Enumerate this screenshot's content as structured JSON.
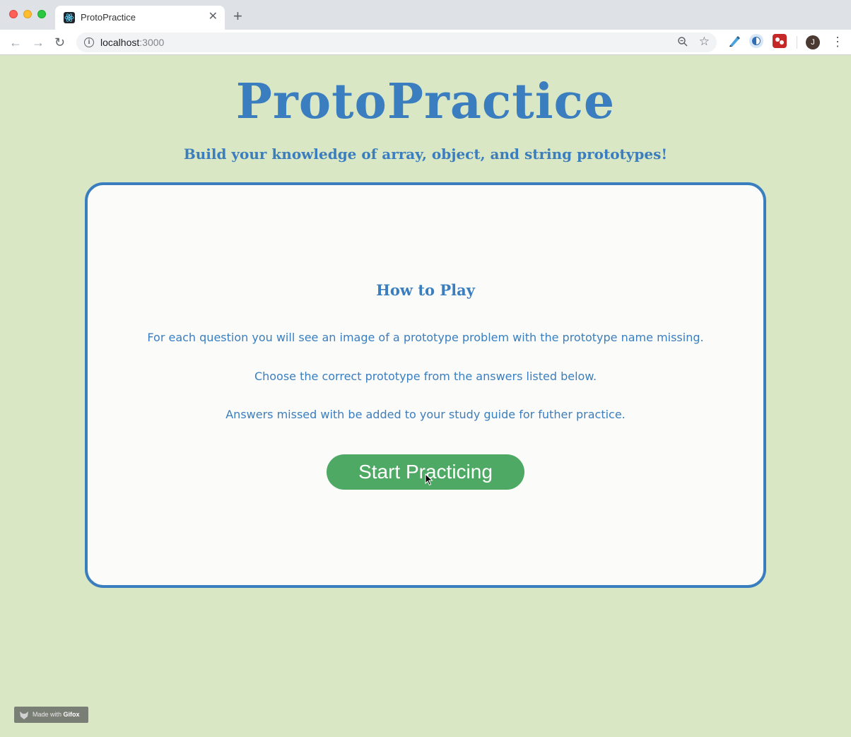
{
  "browser": {
    "tab_title": "ProtoPractice",
    "tab_close": "✕",
    "new_tab": "+",
    "url_host": "localhost",
    "url_port": ":3000",
    "back": "←",
    "forward": "→",
    "reload": "↻",
    "avatar_initial": "J",
    "menu": "⋮"
  },
  "header": {
    "title": "ProtoPractice",
    "subtitle": "Build your knowledge of array, object, and string prototypes!"
  },
  "card": {
    "heading": "How to Play",
    "lines": [
      "For each question you will see an image of a prototype problem with the prototype name missing.",
      "Choose the correct prototype from the answers listed below.",
      "Answers missed with be added to your study guide for futher practice."
    ],
    "button_label": "Start Practicing"
  },
  "watermark": {
    "prefix": "Made with ",
    "brand": "Gifox"
  },
  "colors": {
    "page_bg": "#d9e7c4",
    "accent_blue": "#3a7ebf",
    "button_green": "#4da963",
    "card_bg": "#fbfcfa"
  }
}
